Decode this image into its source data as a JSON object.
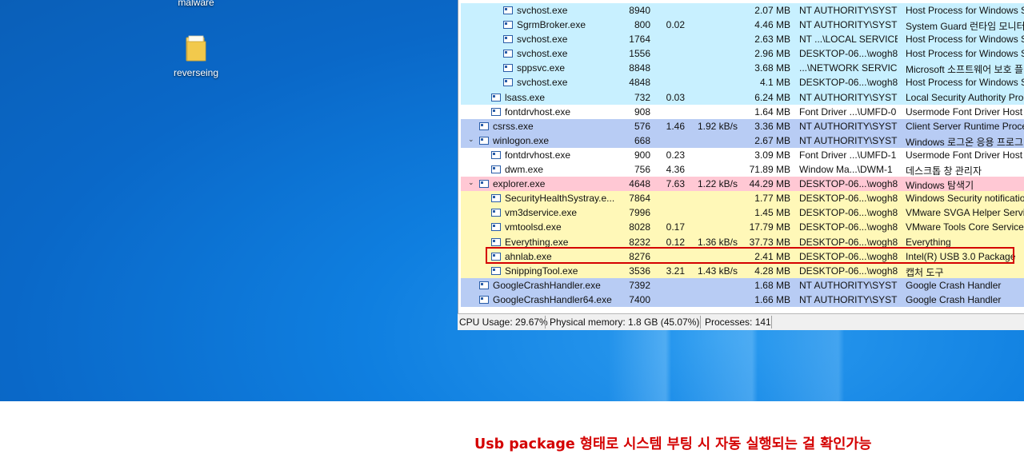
{
  "desktop": {
    "icons": [
      {
        "label": "malware",
        "icon": "app-icon"
      },
      {
        "label": "reverseing",
        "icon": "folder-icon"
      }
    ]
  },
  "process_explorer": {
    "rows": [
      {
        "name": "svchost.exe",
        "pid": "8940",
        "cpu": "",
        "io": "",
        "mem": "2.07 MB",
        "user": "NT AUTHORITY\\SYSTEM",
        "desc": "Host Process for Windows Se",
        "color": "#c8f0ff"
      },
      {
        "name": "SgrmBroker.exe",
        "pid": "800",
        "cpu": "0.02",
        "io": "",
        "mem": "4.46 MB",
        "user": "NT AUTHORITY\\SYSTEM",
        "desc": "System Guard 런타임 모니터",
        "color": "#c8f0ff"
      },
      {
        "name": "svchost.exe",
        "pid": "1764",
        "cpu": "",
        "io": "",
        "mem": "2.63 MB",
        "user": "NT ...\\LOCAL SERVICE",
        "desc": "Host Process for Windows Se",
        "color": "#c8f0ff"
      },
      {
        "name": "svchost.exe",
        "pid": "1556",
        "cpu": "",
        "io": "",
        "mem": "2.96 MB",
        "user": "DESKTOP-06...\\wogh8",
        "desc": "Host Process for Windows Se",
        "color": "#c8f0ff"
      },
      {
        "name": "sppsvc.exe",
        "pid": "8848",
        "cpu": "",
        "io": "",
        "mem": "3.68 MB",
        "user": "...\\NETWORK SERVICE",
        "desc": "Microsoft 소프트웨어 보호 플",
        "color": "#c8f0ff"
      },
      {
        "name": "svchost.exe",
        "pid": "4848",
        "cpu": "",
        "io": "",
        "mem": "4.1 MB",
        "user": "DESKTOP-06...\\wogh8",
        "desc": "Host Process for Windows Se",
        "color": "#c8f0ff"
      },
      {
        "name": "lsass.exe",
        "pid": "732",
        "cpu": "0.03",
        "io": "",
        "mem": "6.24 MB",
        "user": "NT AUTHORITY\\SYSTEM",
        "desc": "Local Security Authority Proc",
        "color": "#c8f0ff"
      },
      {
        "name": "fontdrvhost.exe",
        "pid": "908",
        "cpu": "",
        "io": "",
        "mem": "1.64 MB",
        "user": "Font Driver ...\\UMFD-0",
        "desc": "Usermode Font Driver Host",
        "color": "#ffffff"
      },
      {
        "name": "csrss.exe",
        "pid": "576",
        "cpu": "1.46",
        "io": "1.92 kB/s",
        "mem": "3.36 MB",
        "user": "NT AUTHORITY\\SYSTEM",
        "desc": "Client Server Runtime Proces",
        "color": "#b8ccf4"
      },
      {
        "name": "winlogon.exe",
        "pid": "668",
        "cpu": "",
        "io": "",
        "mem": "2.67 MB",
        "user": "NT AUTHORITY\\SYSTEM",
        "desc": "Windows 로그온 응용 프로그",
        "color": "#b8ccf4"
      },
      {
        "name": "fontdrvhost.exe",
        "pid": "900",
        "cpu": "0.23",
        "io": "",
        "mem": "3.09 MB",
        "user": "Font Driver ...\\UMFD-1",
        "desc": "Usermode Font Driver Host",
        "color": "#ffffff"
      },
      {
        "name": "dwm.exe",
        "pid": "756",
        "cpu": "4.36",
        "io": "",
        "mem": "71.89 MB",
        "user": "Window Ma...\\DWM-1",
        "desc": "데스크톱 창 관리자",
        "color": "#ffffff"
      },
      {
        "name": "explorer.exe",
        "pid": "4648",
        "cpu": "7.63",
        "io": "1.22 kB/s",
        "mem": "44.29 MB",
        "user": "DESKTOP-06...\\wogh8",
        "desc": "Windows 탐색기",
        "color": "#ffc8d4"
      },
      {
        "name": "SecurityHealthSystray.e...",
        "pid": "7864",
        "cpu": "",
        "io": "",
        "mem": "1.77 MB",
        "user": "DESKTOP-06...\\wogh8",
        "desc": "Windows Security notificatio",
        "color": "#fff8b8"
      },
      {
        "name": "vm3dservice.exe",
        "pid": "7996",
        "cpu": "",
        "io": "",
        "mem": "1.45 MB",
        "user": "DESKTOP-06...\\wogh8",
        "desc": "VMware SVGA Helper Service",
        "color": "#fff8b8"
      },
      {
        "name": "vmtoolsd.exe",
        "pid": "8028",
        "cpu": "0.17",
        "io": "",
        "mem": "17.79 MB",
        "user": "DESKTOP-06...\\wogh8",
        "desc": "VMware Tools Core Service",
        "color": "#fff8b8"
      },
      {
        "name": "Everything.exe",
        "pid": "8232",
        "cpu": "0.12",
        "io": "1.36 kB/s",
        "mem": "37.73 MB",
        "user": "DESKTOP-06...\\wogh8",
        "desc": "Everything",
        "color": "#fff8b8"
      },
      {
        "name": "ahnlab.exe",
        "pid": "8276",
        "cpu": "",
        "io": "",
        "mem": "2.41 MB",
        "user": "DESKTOP-06...\\wogh8",
        "desc": "Intel(R) USB 3.0 Package",
        "color": "#fff8b8"
      },
      {
        "name": "SnippingTool.exe",
        "pid": "3536",
        "cpu": "3.21",
        "io": "1.43 kB/s",
        "mem": "4.28 MB",
        "user": "DESKTOP-06...\\wogh8",
        "desc": "캡처 도구",
        "color": "#fff8b8"
      },
      {
        "name": "GoogleCrashHandler.exe",
        "pid": "7392",
        "cpu": "",
        "io": "",
        "mem": "1.68 MB",
        "user": "NT AUTHORITY\\SYSTEM",
        "desc": "Google Crash Handler",
        "color": "#b8ccf4"
      },
      {
        "name": "GoogleCrashHandler64.exe",
        "pid": "7400",
        "cpu": "",
        "io": "",
        "mem": "1.66 MB",
        "user": "NT AUTHORITY\\SYSTEM",
        "desc": "Google Crash Handler",
        "color": "#b8ccf4"
      }
    ],
    "status": {
      "cpu": "CPU Usage: 29.67%",
      "memory": "Physical memory: 1.8 GB (45.07%)",
      "processes": "Processes: 141"
    }
  },
  "caption": "Usb package 형태로 시스템 부팅 시 자동 실행되는 걸 확인가능",
  "colors": {
    "highlight_border": "#d40000",
    "caption": "#d40000"
  }
}
